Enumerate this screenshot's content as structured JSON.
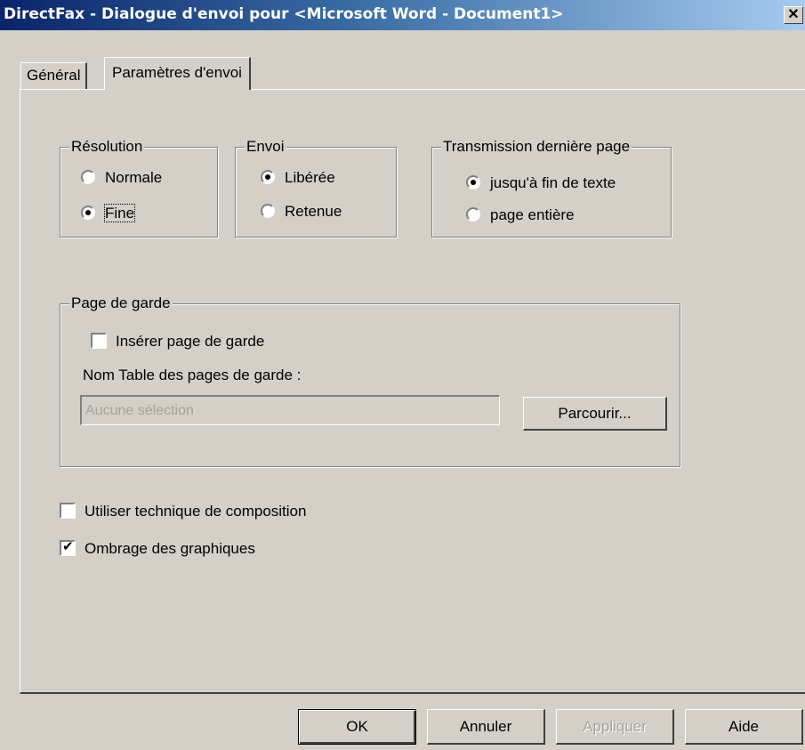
{
  "window": {
    "title": "DirectFax - Dialogue d'envoi pour <Microsoft Word - Document1>",
    "close_glyph": "✕"
  },
  "tabs": [
    {
      "label": "Général",
      "active": false
    },
    {
      "label": "Paramètres d'envoi",
      "active": true
    }
  ],
  "resolution": {
    "legend": "Résolution",
    "options": [
      {
        "label": "Normale",
        "selected": false
      },
      {
        "label": "Fine",
        "selected": true
      }
    ]
  },
  "envoi": {
    "legend": "Envoi",
    "options": [
      {
        "label": "Libérée",
        "selected": true
      },
      {
        "label": "Retenue",
        "selected": false
      }
    ]
  },
  "transmission": {
    "legend": "Transmission dernière page",
    "options": [
      {
        "label": "jusqu'à fin de texte",
        "selected": true
      },
      {
        "label": "page entière",
        "selected": false
      }
    ]
  },
  "page_de_garde": {
    "legend": "Page de garde",
    "insert_label": "Insérer page de garde",
    "insert_checked": false,
    "table_label": "Nom Table des pages de garde :",
    "table_value": "Aucune sélection",
    "browse_label": "Parcourir..."
  },
  "options": {
    "composition_label": "Utiliser technique de composition",
    "composition_checked": false,
    "ombrage_label": "Ombrage des graphiques",
    "ombrage_checked": true
  },
  "buttons": {
    "ok": "OK",
    "cancel": "Annuler",
    "apply": "Appliquer",
    "help": "Aide"
  }
}
